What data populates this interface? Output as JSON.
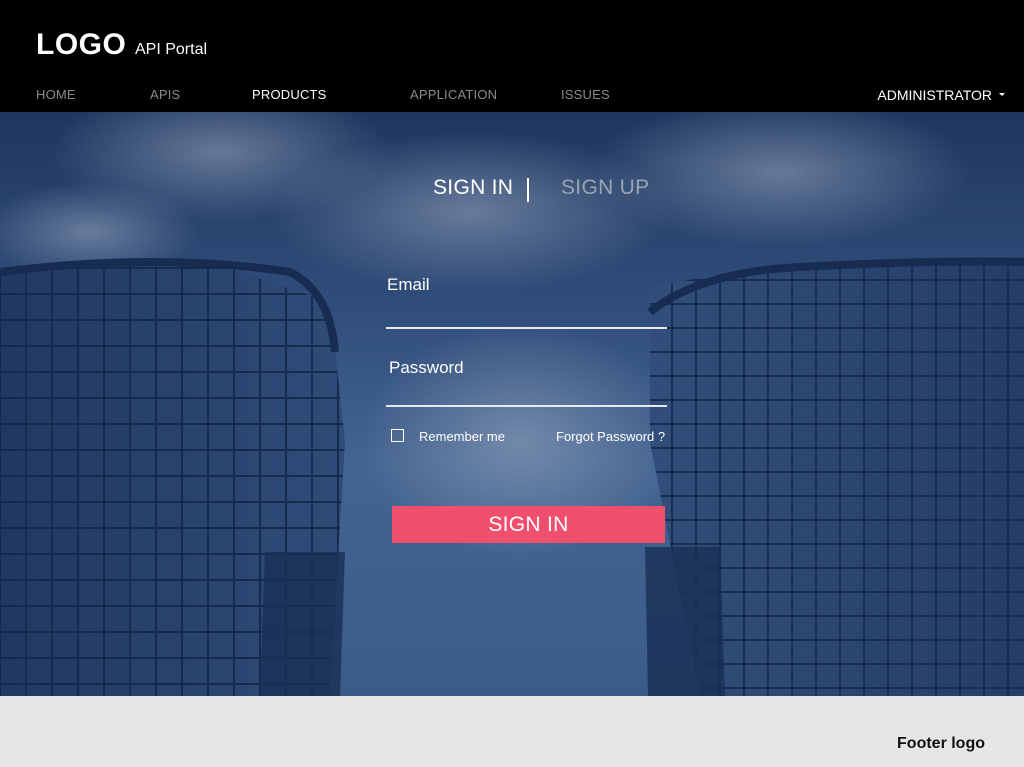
{
  "header": {
    "logo": "LOGO",
    "portal_name": "API Portal",
    "nav": [
      {
        "label": "HOME",
        "active": false
      },
      {
        "label": "APIS",
        "active": false
      },
      {
        "label": "PRODUCTS",
        "active": true
      },
      {
        "label": "APPLICATION",
        "active": false
      },
      {
        "label": "ISSUES",
        "active": false
      }
    ],
    "user_menu": "ADMINISTRATOR"
  },
  "auth": {
    "tab_signin": "SIGN IN",
    "tab_signup": "SIGN UP",
    "email_label": "Email",
    "email_value": "",
    "password_label": "Password",
    "password_value": "",
    "remember_label": "Remember me",
    "remember_checked": false,
    "forgot_label": "Forgot Password ?",
    "submit_label": "SIGN IN"
  },
  "footer": {
    "logo_text": "Footer logo"
  },
  "colors": {
    "header_bg": "#000000",
    "accent": "#f0506e",
    "footer_bg": "#e6e6e6",
    "inactive_tab": "#9aa4b3"
  }
}
